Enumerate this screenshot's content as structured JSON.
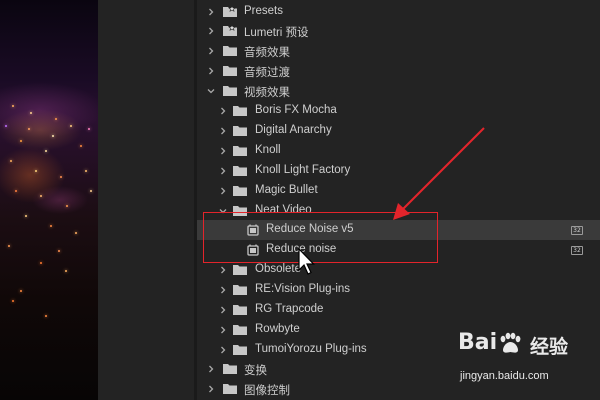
{
  "tree": {
    "items": [
      {
        "label": "Presets",
        "icon": "preset-folder-icon",
        "expanded": false
      },
      {
        "label": "Lumetri 预设",
        "icon": "preset-folder-icon",
        "expanded": false
      },
      {
        "label": "音频效果",
        "icon": "folder-icon",
        "expanded": false
      },
      {
        "label": "音频过渡",
        "icon": "folder-icon",
        "expanded": false
      },
      {
        "label": "视频效果",
        "icon": "folder-icon",
        "expanded": true
      },
      {
        "label": "Boris FX Mocha",
        "icon": "folder-icon",
        "expanded": false
      },
      {
        "label": "Digital Anarchy",
        "icon": "folder-icon",
        "expanded": false
      },
      {
        "label": "Knoll",
        "icon": "folder-icon",
        "expanded": false
      },
      {
        "label": "Knoll Light Factory",
        "icon": "folder-icon",
        "expanded": false
      },
      {
        "label": "Magic Bullet",
        "icon": "folder-icon",
        "expanded": false
      },
      {
        "label": "Neat Video",
        "icon": "folder-icon",
        "expanded": true
      },
      {
        "label": "Reduce Noise v5",
        "icon": "effect-icon",
        "badge": "32"
      },
      {
        "label": "Reduce noise",
        "icon": "effect-icon",
        "badge": "32"
      },
      {
        "label": "Obsolete",
        "icon": "folder-icon",
        "expanded": false
      },
      {
        "label": "RE:Vision Plug-ins",
        "icon": "folder-icon",
        "expanded": false
      },
      {
        "label": "RG Trapcode",
        "icon": "folder-icon",
        "expanded": false
      },
      {
        "label": "Rowbyte",
        "icon": "folder-icon",
        "expanded": false
      },
      {
        "label": "TumoiYorozu Plug-ins",
        "icon": "folder-icon",
        "expanded": false
      },
      {
        "label": "变换",
        "icon": "folder-icon",
        "expanded": false
      },
      {
        "label": "图像控制",
        "icon": "folder-icon",
        "expanded": false
      }
    ]
  },
  "watermark": {
    "logo": "Bai",
    "logo_suffix": "du",
    "chinese": "经验",
    "url": "jingyan.baidu.com"
  },
  "colors": {
    "panel_bg": "#232323",
    "selected_row": "#3a3a3a",
    "text": "#cfcfcf",
    "annotation_red": "#e3242b"
  }
}
